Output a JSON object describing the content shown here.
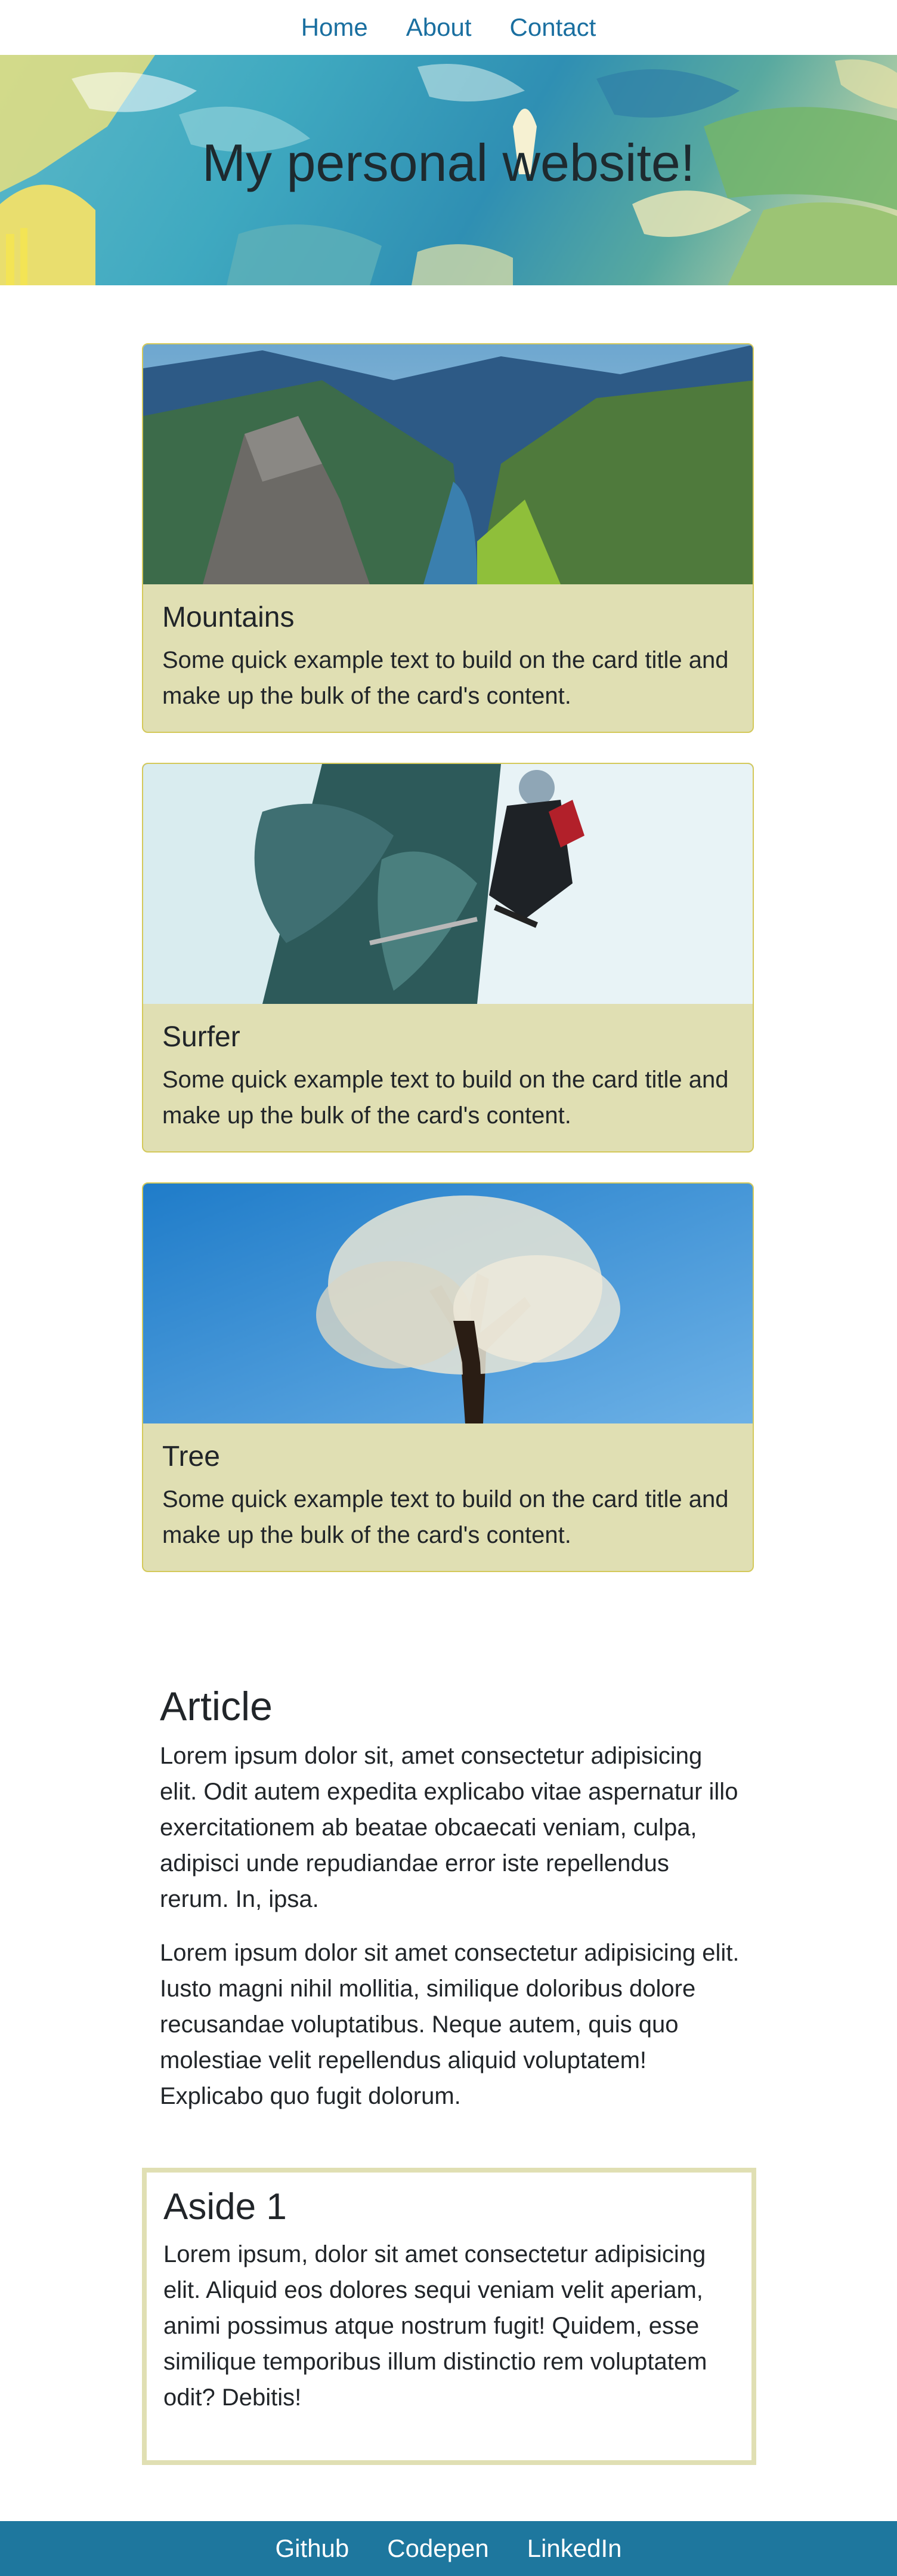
{
  "nav": {
    "items": [
      "Home",
      "About",
      "Contact"
    ]
  },
  "hero": {
    "title": "My personal website!"
  },
  "cards": [
    {
      "title": "Mountains",
      "text": "Some quick example text to build on the card title and make up the bulk of the card's content.",
      "image": "mountain-fjord-photo"
    },
    {
      "title": "Surfer",
      "text": "Some quick example text to build on the card title and make up the bulk of the card's content.",
      "image": "kayaker-whitewater-photo"
    },
    {
      "title": "Tree",
      "text": "Some quick example text to build on the card title and make up the bulk of the card's content.",
      "image": "blossom-tree-photo"
    }
  ],
  "article": {
    "title": "Article",
    "paragraphs": [
      "Lorem ipsum dolor sit, amet consectetur adipisicing elit. Odit autem expedita explicabo vitae aspernatur illo exercitationem ab beatae obcaecati veniam, culpa, adipisci unde repudiandae error iste repellendus rerum. In, ipsa.",
      "Lorem ipsum dolor sit amet consectetur adipisicing elit. Iusto magni nihil mollitia, similique doloribus dolore recusandae voluptatibus. Neque autem, quis quo molestiae velit repellendus aliquid voluptatem! Explicabo quo fugit dolorum."
    ]
  },
  "aside": {
    "title": "Aside 1",
    "text": "Lorem ipsum, dolor sit amet consectetur adipisicing elit. Aliquid eos dolores sequi veniam velit aperiam, animi possimus atque nostrum fugit! Quidem, esse similique temporibus illum distinctio rem voluptatem odit? Debitis!"
  },
  "footer": {
    "links": [
      "Github",
      "Codepen",
      "LinkedIn"
    ]
  },
  "colors": {
    "nav_link": "#1a6fa0",
    "card_bg": "#e0dfb3",
    "card_border": "#d4c95a",
    "footer_bg": "#1e779e"
  }
}
